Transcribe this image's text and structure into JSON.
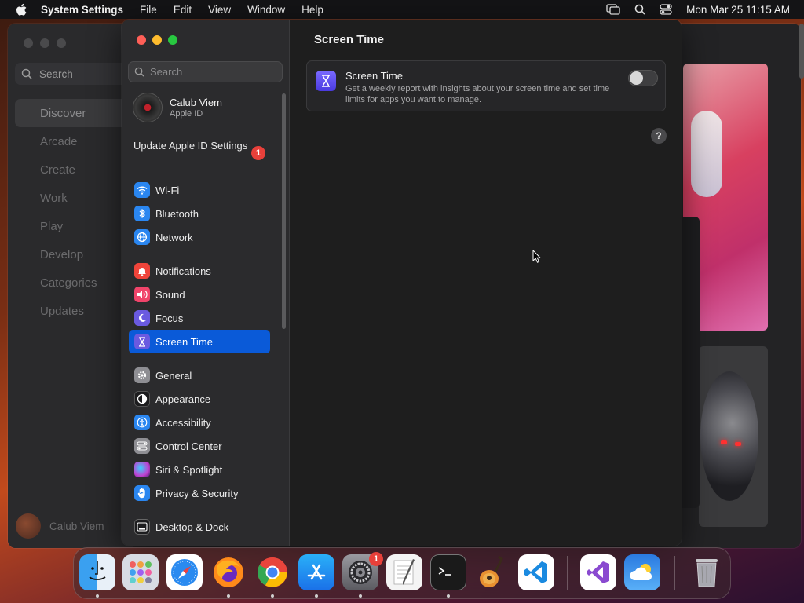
{
  "menubar": {
    "app_name": "System Settings",
    "menus": [
      "File",
      "Edit",
      "View",
      "Window",
      "Help"
    ],
    "datetime": "Mon Mar 25  11:15 AM"
  },
  "background_window": {
    "search_placeholder": "Search",
    "nav": [
      "Discover",
      "Arcade",
      "Create",
      "Work",
      "Play",
      "Develop",
      "Categories",
      "Updates"
    ],
    "active_nav": "Discover",
    "user_name": "Calub Viem"
  },
  "settings": {
    "search_placeholder": "Search",
    "account": {
      "name": "Calub Viem",
      "subtitle": "Apple ID"
    },
    "update_label": "Update Apple ID Settings",
    "update_badge": "1",
    "groups": [
      [
        {
          "label": "Wi-Fi",
          "icon": "wifi-icon",
          "color": "#2a86f0"
        },
        {
          "label": "Bluetooth",
          "icon": "bluetooth-icon",
          "color": "#2a86f0"
        },
        {
          "label": "Network",
          "icon": "globe-icon",
          "color": "#2a86f0"
        }
      ],
      [
        {
          "label": "Notifications",
          "icon": "bell-icon",
          "color": "#f0443a"
        },
        {
          "label": "Sound",
          "icon": "speaker-icon",
          "color": "#f0446a"
        },
        {
          "label": "Focus",
          "icon": "moon-icon",
          "color": "#6a5ae0"
        },
        {
          "label": "Screen Time",
          "icon": "hourglass-icon",
          "color": "#6a5ae0",
          "active": true
        }
      ],
      [
        {
          "label": "General",
          "icon": "gear-icon",
          "color": "#8e8e93"
        },
        {
          "label": "Appearance",
          "icon": "appearance-icon",
          "color": "#1c1c1e"
        },
        {
          "label": "Accessibility",
          "icon": "accessibility-icon",
          "color": "#2a86f0"
        },
        {
          "label": "Control Center",
          "icon": "control-center-icon",
          "color": "#8e8e93"
        },
        {
          "label": "Siri & Spotlight",
          "icon": "siri-icon",
          "color": "#c040d0"
        },
        {
          "label": "Privacy & Security",
          "icon": "hand-icon",
          "color": "#2a86f0"
        }
      ],
      [
        {
          "label": "Desktop & Dock",
          "icon": "dock-icon",
          "color": "#1c1c1e"
        }
      ]
    ],
    "content": {
      "title": "Screen Time",
      "card_title": "Screen Time",
      "card_description": "Get a weekly report with insights about your screen time and set time limits for apps you want to manage.",
      "toggle_on": false,
      "help_label": "?"
    }
  },
  "dock": {
    "apps": [
      "Finder",
      "Launchpad",
      "Safari",
      "Firefox",
      "Chrome",
      "App Store",
      "System Settings",
      "TextEdit",
      "Terminal",
      "GarageBand",
      "VS Code",
      "Visual Studio",
      "Weather",
      "Trash"
    ],
    "settings_badge": "1"
  },
  "colors": {
    "accent": "#0a5ad8",
    "badge": "#e8403a"
  }
}
